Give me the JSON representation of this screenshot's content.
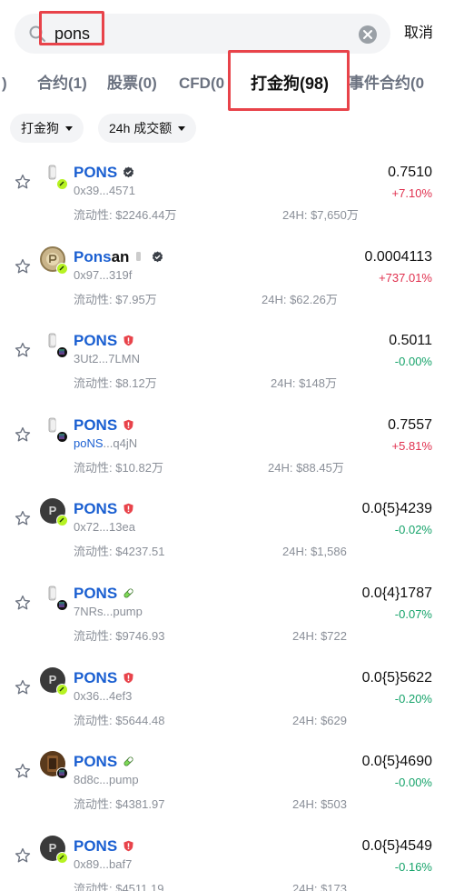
{
  "search": {
    "query": "pons",
    "cancel_label": "取消"
  },
  "tabs": [
    {
      "label": ")",
      "active": false
    },
    {
      "label": "合约(1)",
      "active": false
    },
    {
      "label": "股票(0)",
      "active": false
    },
    {
      "label": "CFD(0",
      "active": false
    },
    {
      "label": "打金狗(98)",
      "active": true
    },
    {
      "label": "事件合约(0",
      "active": false
    }
  ],
  "filters": {
    "category": "打金狗",
    "sort": "24h 成交额"
  },
  "colors": {
    "up": "#e0304e",
    "down": "#16a36a",
    "link": "#1a5fd1",
    "highlight": "#e8434a"
  },
  "tokens": [
    {
      "name": "PONS",
      "badge": "verified-icon",
      "chain": "lime",
      "avatar": "pons-logo-icon",
      "address": "0x39...4571",
      "liquidity": "流动性: $2246.44万",
      "volume": "24H: $7,650万",
      "price": "0.7510",
      "change": "+7.10%",
      "trend": "up"
    },
    {
      "name_bold": "Pons",
      "name_rest": "an",
      "badge": "verified-icon",
      "chain": "lime",
      "avatar": "coin-avatar-icon",
      "address": "0x97...319f",
      "liquidity": "流动性: $7.95万",
      "volume": "24H: $62.26万",
      "price": "0.0004113",
      "change": "+737.01%",
      "trend": "up"
    },
    {
      "name": "PONS",
      "badge": "warning-icon",
      "chain": "solana",
      "avatar": "pons-logo-icon",
      "address": "3Ut2...7LMN",
      "liquidity": "流动性: $8.12万",
      "volume": "24H: $148万",
      "price": "0.5011",
      "change": "-0.00%",
      "trend": "flat"
    },
    {
      "name": "PONS",
      "badge": "warning-icon",
      "chain": "solana",
      "avatar": "pons-logo-icon",
      "address_bold": "poNS",
      "address_rest": "...q4jN",
      "liquidity": "流动性: $10.82万",
      "volume": "24H: $88.45万",
      "price": "0.7557",
      "change": "+5.81%",
      "trend": "up"
    },
    {
      "name": "PONS",
      "badge": "warning-icon",
      "chain": "lime",
      "avatar": "letter-p-avatar",
      "avatar_letter": "P",
      "address": "0x72...13ea",
      "liquidity": "流动性: $4237.51",
      "volume": "24H: $1,586",
      "price": "0.0{5}4239",
      "change": "-0.02%",
      "trend": "flat"
    },
    {
      "name": "PONS",
      "badge": "pill-icon",
      "chain": "solana",
      "avatar": "pons-logo-icon",
      "address": "7NRs...pump",
      "liquidity": "流动性: $9746.93",
      "volume": "24H: $722",
      "price": "0.0{4}1787",
      "change": "-0.07%",
      "trend": "flat"
    },
    {
      "name": "PONS",
      "badge": "warning-icon",
      "chain": "lime",
      "avatar": "letter-p-avatar",
      "avatar_letter": "P",
      "address": "0x36...4ef3",
      "liquidity": "流动性: $5644.48",
      "volume": "24H: $629",
      "price": "0.0{5}5622",
      "change": "-0.20%",
      "trend": "flat"
    },
    {
      "name": "PONS",
      "badge": "pill-icon",
      "chain": "solana",
      "avatar": "brown-avatar",
      "address": "8d8c...pump",
      "liquidity": "流动性: $4381.97",
      "volume": "24H: $503",
      "price": "0.0{5}4690",
      "change": "-0.00%",
      "trend": "flat"
    },
    {
      "name": "PONS",
      "badge": "warning-icon",
      "chain": "lime",
      "avatar": "letter-p-avatar",
      "avatar_letter": "P",
      "address": "0x89...baf7",
      "liquidity": "流动性: $4511.19",
      "volume": "24H: $173",
      "price": "0.0{5}4549",
      "change": "-0.16%",
      "trend": "flat"
    }
  ]
}
